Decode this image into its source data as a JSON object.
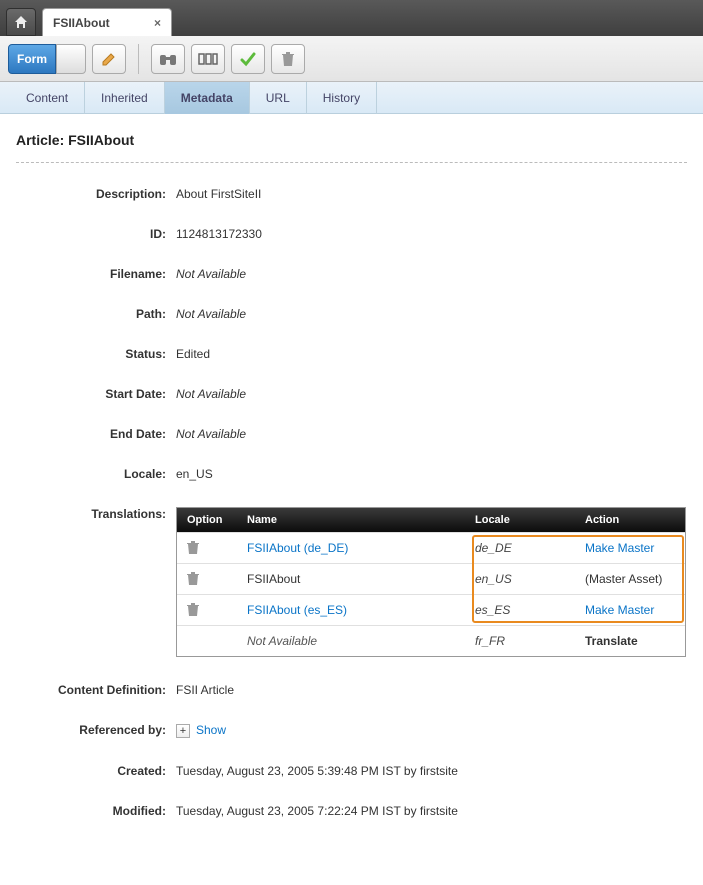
{
  "tab": {
    "title": "FSIIAbout"
  },
  "toolbar": {
    "form_label": "Form"
  },
  "subnav": [
    "Content",
    "Inherited",
    "Metadata",
    "URL",
    "History"
  ],
  "page": {
    "title": "Article: FSIIAbout"
  },
  "fields": {
    "description": {
      "label": "Description:",
      "value": "About FirstSiteII"
    },
    "id": {
      "label": "ID:",
      "value": "1124813172330"
    },
    "filename": {
      "label": "Filename:",
      "value": "Not Available",
      "na": true
    },
    "path": {
      "label": "Path:",
      "value": "Not Available",
      "na": true
    },
    "status": {
      "label": "Status:",
      "value": "Edited"
    },
    "start_date": {
      "label": "Start Date:",
      "value": "Not Available",
      "na": true
    },
    "end_date": {
      "label": "End Date:",
      "value": "Not Available",
      "na": true
    },
    "locale": {
      "label": "Locale:",
      "value": "en_US"
    },
    "translations": {
      "label": "Translations:"
    },
    "content_def": {
      "label": "Content Definition:",
      "value": "FSII Article"
    },
    "referenced_by": {
      "label": "Referenced by:",
      "value": "Show"
    },
    "created": {
      "label": "Created:",
      "value": "Tuesday, August 23, 2005 5:39:48 PM IST by firstsite"
    },
    "modified": {
      "label": "Modified:",
      "value": "Tuesday, August 23, 2005 7:22:24 PM IST by firstsite"
    }
  },
  "table": {
    "headers": [
      "Option",
      "Name",
      "Locale",
      "Action"
    ],
    "rows": [
      {
        "trash": true,
        "name": "FSIIAbout (de_DE)",
        "name_link": true,
        "locale": "de_DE",
        "action": "Make Master",
        "action_link": true
      },
      {
        "trash": true,
        "name": "FSIIAbout",
        "name_link": false,
        "locale": "en_US",
        "action": "(Master Asset)",
        "action_link": false
      },
      {
        "trash": true,
        "name": "FSIIAbout (es_ES)",
        "name_link": true,
        "locale": "es_ES",
        "action": "Make Master",
        "action_link": true
      },
      {
        "trash": false,
        "name": "Not Available",
        "name_na": true,
        "locale": "fr_FR",
        "action": "Translate",
        "action_bold": true
      }
    ]
  }
}
